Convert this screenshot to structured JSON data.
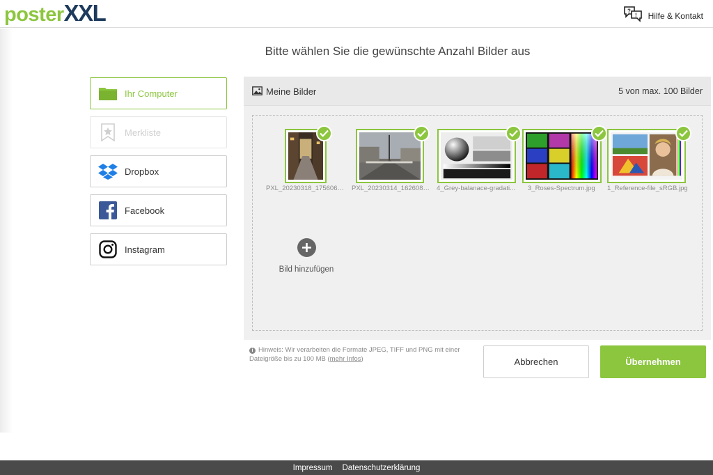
{
  "header": {
    "logo_part1": "poster",
    "logo_part2": "XXL",
    "help_label": "Hilfe & Kontakt"
  },
  "title": "Bitte wählen Sie die gewünschte Anzahl Bilder aus",
  "sources": [
    {
      "label": "Ihr Computer",
      "icon": "folder-icon",
      "state": "active"
    },
    {
      "label": "Merkliste",
      "icon": "bookmark-star-icon",
      "state": "disabled"
    },
    {
      "label": "Dropbox",
      "icon": "dropbox-icon",
      "state": "normal"
    },
    {
      "label": "Facebook",
      "icon": "facebook-icon",
      "state": "normal"
    },
    {
      "label": "Instagram",
      "icon": "instagram-icon",
      "state": "normal"
    }
  ],
  "gallery": {
    "title": "Meine Bilder",
    "count": "5 von max. 100 Bilder",
    "images": [
      {
        "filename": "PXL_20230318_1756066...",
        "selected": true
      },
      {
        "filename": "PXL_20230314_1626084...",
        "selected": true
      },
      {
        "filename": "4_Grey-balanace-gradati...",
        "selected": true
      },
      {
        "filename": "3_Roses-Spectrum.jpg",
        "selected": true
      },
      {
        "filename": "1_Reference-file_sRGB.jpg",
        "selected": true
      }
    ],
    "add_label": "Bild hinzufügen"
  },
  "note": {
    "text": "Hinweis: Wir verarbeiten die Formate JPEG, TIFF und PNG mit einer Dateigröße bis zu 100 MB",
    "link": "mehr Infos"
  },
  "buttons": {
    "cancel": "Abbrechen",
    "confirm": "Übernehmen"
  },
  "footer": {
    "links": [
      "Impressum",
      "Datenschutzerklärung"
    ]
  },
  "colors": {
    "accent": "#8cc63f",
    "brand_dark": "#1e3a5c",
    "footer_bg": "#4a4a4a"
  }
}
